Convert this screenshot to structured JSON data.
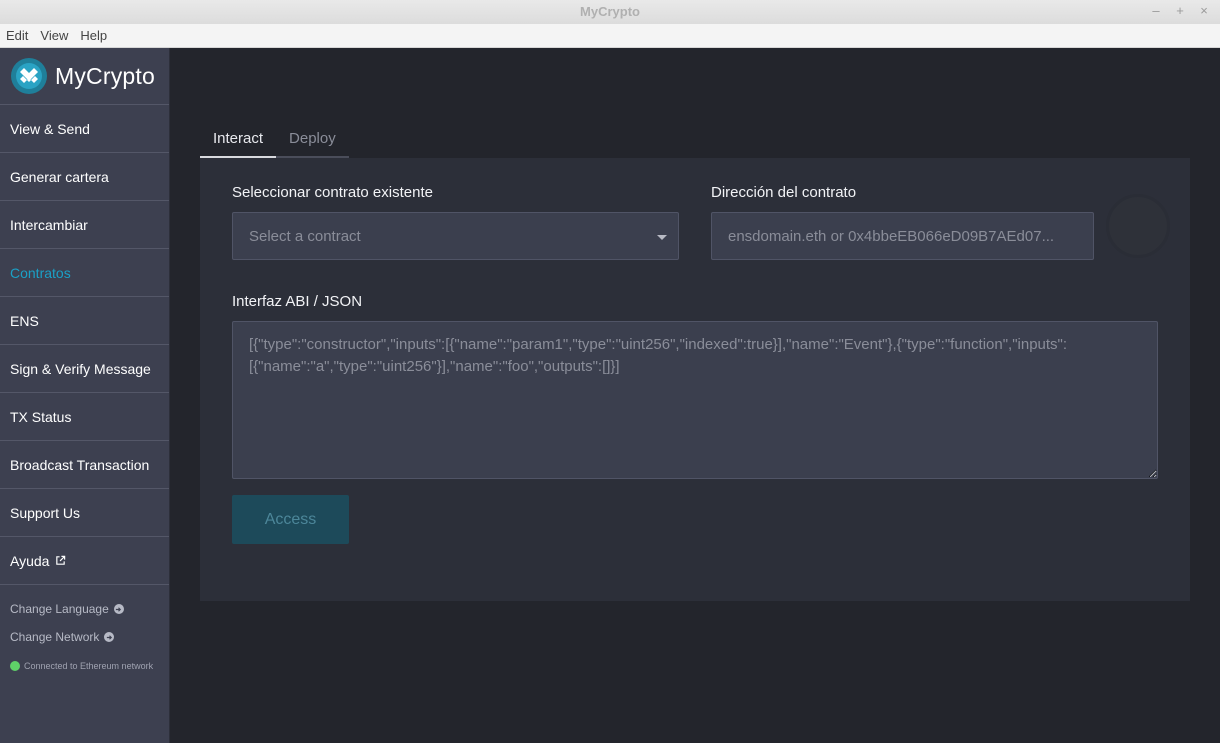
{
  "window": {
    "title": "MyCrypto",
    "controls": [
      "–",
      "+",
      "×"
    ]
  },
  "menubar": {
    "items": [
      "Edit",
      "View",
      "Help"
    ]
  },
  "sidebar": {
    "brand": "MyCrypto",
    "items": [
      {
        "label": "View & Send"
      },
      {
        "label": "Generar cartera"
      },
      {
        "label": "Intercambiar"
      },
      {
        "label": "Contratos",
        "active": true
      },
      {
        "label": "ENS"
      },
      {
        "label": "Sign & Verify Message"
      },
      {
        "label": "TX Status"
      },
      {
        "label": "Broadcast Transaction"
      },
      {
        "label": "Support Us"
      },
      {
        "label": "Ayuda",
        "icon": "external-link-icon"
      }
    ],
    "change_language": "Change Language",
    "change_network": "Change Network",
    "status": "Connected to Ethereum network",
    "status_color": "#5fd068"
  },
  "tabs": [
    {
      "label": "Interact",
      "active": true
    },
    {
      "label": "Deploy",
      "active": false
    }
  ],
  "form": {
    "select_label": "Seleccionar contrato existente",
    "select_value": "Select a contract",
    "address_label": "Dirección del contrato",
    "address_placeholder": "ensdomain.eth or 0x4bbeEB066eD09B7AEd07...",
    "abi_label": "Interfaz ABI / JSON",
    "abi_placeholder": "[{\"type\":\"constructor\",\"inputs\":[{\"name\":\"param1\",\"type\":\"uint256\",\"indexed\":true}],\"name\":\"Event\"},{\"type\":\"function\",\"inputs\":[{\"name\":\"a\",\"type\":\"uint256\"}],\"name\":\"foo\",\"outputs\":[]}]",
    "access_label": "Access"
  },
  "colors": {
    "accent": "#1ba0c6",
    "sidebar_bg": "#3d4050",
    "panel_bg": "#2c2f39",
    "access_bg": "#1d4a5a"
  }
}
